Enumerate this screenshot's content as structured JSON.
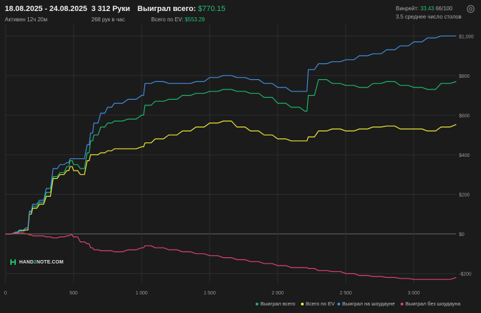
{
  "header": {
    "date_range": "18.08.2025 - 24.08.2025",
    "active": "Активен 12ч 20м",
    "hands": "3 312 Руки",
    "hands_per_hour": "268 рук в час",
    "won_label": "Выиграл всего:",
    "won_value": "$770.15",
    "ev_label": "Всего по EV:",
    "ev_value": "$553.29",
    "winrate_label": "Винрейт:",
    "winrate_value": "33.43",
    "winrate_sample": "66/100",
    "tables": "3.5 среднее число столов",
    "gear_icon": "gear-icon"
  },
  "logo": {
    "text_a": "HAND",
    "text_b": "2",
    "text_c": "NOTE.COM",
    "icon": "hand2note-logo-icon"
  },
  "colors": {
    "background": "#1b1b1b",
    "grid": "#2e2e2e",
    "zero_line": "#6a6a6a",
    "won": "#1fb56b",
    "ev": "#f2e93a",
    "showdown": "#3f8fe0",
    "non_showdown": "#e0436e",
    "accent": "#27c07a"
  },
  "chart_data": {
    "type": "line",
    "xlabel": "",
    "ylabel": "",
    "xlim": [
      0,
      3312
    ],
    "ylim": [
      -250,
      1060
    ],
    "x_ticks": [
      0,
      500,
      1000,
      1500,
      2000,
      2500,
      3000
    ],
    "x_tick_labels": [
      "0",
      "500",
      "1 000",
      "1 500",
      "2 000",
      "2 500",
      "3 000"
    ],
    "y_ticks": [
      -200,
      0,
      200,
      400,
      600,
      800,
      1000
    ],
    "y_tick_labels": [
      "-$200",
      "$0",
      "$200",
      "$400",
      "$600",
      "$800",
      "$1,000"
    ],
    "legend_position": "bottom-right",
    "x": [
      0,
      75,
      100,
      150,
      175,
      200,
      250,
      300,
      350,
      400,
      450,
      475,
      500,
      550,
      600,
      625,
      650,
      700,
      750,
      800,
      900,
      1000,
      1025,
      1100,
      1200,
      1300,
      1400,
      1500,
      1600,
      1700,
      1800,
      1900,
      2000,
      2100,
      2200,
      2225,
      2300,
      2400,
      2500,
      2600,
      2700,
      2800,
      2900,
      3000,
      3100,
      3200,
      3312
    ],
    "series": [
      {
        "name": "Выиграл всего",
        "color": "#1fb56b",
        "values": [
          0,
          10,
          20,
          30,
          110,
          140,
          160,
          210,
          290,
          310,
          340,
          370,
          350,
          330,
          410,
          470,
          500,
          540,
          560,
          570,
          580,
          600,
          650,
          670,
          680,
          700,
          710,
          720,
          730,
          720,
          710,
          690,
          660,
          640,
          620,
          700,
          780,
          760,
          750,
          740,
          760,
          770,
          750,
          740,
          730,
          760,
          770
        ]
      },
      {
        "name": "Всего по EV",
        "color": "#f2e93a",
        "values": [
          0,
          5,
          15,
          20,
          100,
          130,
          150,
          190,
          280,
          300,
          320,
          340,
          320,
          300,
          370,
          400,
          400,
          410,
          420,
          430,
          430,
          440,
          460,
          480,
          500,
          520,
          540,
          560,
          570,
          540,
          520,
          500,
          480,
          470,
          470,
          490,
          520,
          530,
          520,
          530,
          540,
          545,
          530,
          530,
          520,
          540,
          553
        ]
      },
      {
        "name": "Выиграл на шоудауне",
        "color": "#3f8fe0",
        "values": [
          0,
          8,
          18,
          30,
          115,
          150,
          170,
          230,
          330,
          350,
          360,
          380,
          380,
          380,
          450,
          510,
          560,
          610,
          640,
          660,
          680,
          700,
          760,
          770,
          760,
          760,
          770,
          790,
          800,
          790,
          780,
          760,
          740,
          720,
          720,
          830,
          860,
          870,
          880,
          900,
          910,
          930,
          950,
          970,
          990,
          1000,
          1000
        ]
      },
      {
        "name": "Выиграл без шоудауна",
        "color": "#e0436e",
        "values": [
          0,
          5,
          5,
          0,
          -5,
          -10,
          -10,
          -15,
          -20,
          -15,
          -10,
          -5,
          -15,
          -40,
          -50,
          -70,
          -80,
          -85,
          -85,
          -90,
          -80,
          -70,
          -60,
          -70,
          -80,
          -90,
          -100,
          -110,
          -120,
          -130,
          -140,
          -150,
          -160,
          -170,
          -170,
          -175,
          -185,
          -190,
          -200,
          -210,
          -215,
          -220,
          -225,
          -230,
          -230,
          -230,
          -220
        ]
      }
    ]
  }
}
